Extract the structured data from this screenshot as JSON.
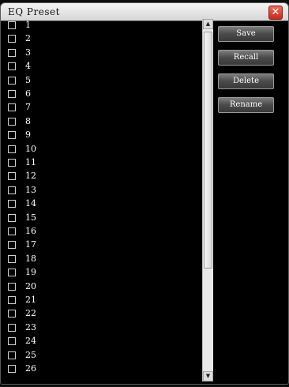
{
  "dialog": {
    "title": "EQ Preset",
    "close_glyph": "✕",
    "close_icon": "close-icon"
  },
  "presets": [
    {
      "label": "1",
      "checked": false
    },
    {
      "label": "2",
      "checked": false
    },
    {
      "label": "3",
      "checked": false
    },
    {
      "label": "4",
      "checked": false
    },
    {
      "label": "5",
      "checked": false
    },
    {
      "label": "6",
      "checked": false
    },
    {
      "label": "7",
      "checked": false
    },
    {
      "label": "8",
      "checked": false
    },
    {
      "label": "9",
      "checked": false
    },
    {
      "label": "10",
      "checked": false
    },
    {
      "label": "11",
      "checked": false
    },
    {
      "label": "12",
      "checked": false
    },
    {
      "label": "13",
      "checked": false
    },
    {
      "label": "14",
      "checked": false
    },
    {
      "label": "15",
      "checked": false
    },
    {
      "label": "16",
      "checked": false
    },
    {
      "label": "17",
      "checked": false
    },
    {
      "label": "18",
      "checked": false
    },
    {
      "label": "19",
      "checked": false
    },
    {
      "label": "20",
      "checked": false
    },
    {
      "label": "21",
      "checked": false
    },
    {
      "label": "22",
      "checked": false
    },
    {
      "label": "23",
      "checked": false
    },
    {
      "label": "24",
      "checked": false
    },
    {
      "label": "25",
      "checked": false
    },
    {
      "label": "26",
      "checked": false
    }
  ],
  "actions": {
    "save_label": "Save",
    "recall_label": "Recall",
    "delete_label": "Delete",
    "rename_label": "Rename"
  },
  "scrollbar": {
    "up_glyph": "▲",
    "down_glyph": "▼"
  },
  "colors": {
    "close_button": "#d9342b",
    "accent_green": "#114a2a"
  }
}
